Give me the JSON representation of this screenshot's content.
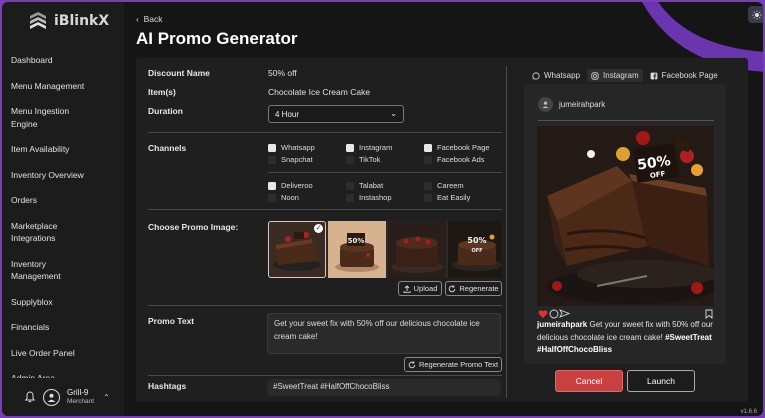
{
  "app": {
    "logo_text": "iBlinkX",
    "theme_icon": "sun-icon"
  },
  "sidebar": {
    "items": [
      {
        "label": "Dashboard"
      },
      {
        "label": "Menu Management"
      },
      {
        "label": "Menu Ingestion Engine"
      },
      {
        "label": "Item Availability"
      },
      {
        "label": "Inventory Overview"
      },
      {
        "label": "Orders"
      },
      {
        "label": "Marketplace Integrations"
      },
      {
        "label": "Inventory Management"
      },
      {
        "label": "Supplyblox"
      },
      {
        "label": "Financials"
      },
      {
        "label": "Live Order Panel"
      },
      {
        "label": "Admin Area"
      }
    ],
    "user": {
      "name": "Grill-9",
      "role": "Merchant"
    }
  },
  "header": {
    "back_label": "Back",
    "title": "AI Promo Generator"
  },
  "form": {
    "discount_label": "Discount Name",
    "discount_value": "50% off",
    "items_label": "Item(s)",
    "items_value": "Chocolate Ice Cream Cake",
    "duration_label": "Duration",
    "duration_value": "4 Hour",
    "channels_label": "Channels",
    "channels": [
      {
        "label": "Whatsapp",
        "checked": true
      },
      {
        "label": "Instagram",
        "checked": true
      },
      {
        "label": "Facebook Page",
        "checked": true
      },
      {
        "label": "Snapchat",
        "checked": false
      },
      {
        "label": "TikTok",
        "checked": false
      },
      {
        "label": "Facebook Ads",
        "checked": false
      },
      {
        "label": "Deliveroo",
        "checked": true
      },
      {
        "label": "Talabat",
        "checked": false
      },
      {
        "label": "Careem",
        "checked": false
      },
      {
        "label": "Noon",
        "checked": false
      },
      {
        "label": "Instashop",
        "checked": false
      },
      {
        "label": "Eat Easily",
        "checked": false
      }
    ],
    "image_label": "Choose Promo Image:",
    "upload_label": "Upload",
    "regenerate_label": "Regenerate",
    "promo_text_label": "Promo Text",
    "promo_text": "Get your sweet fix with 50% off our delicious chocolate ice cream cake!",
    "regenerate_text_label": "Regenerate Promo Text",
    "hashtags_label": "Hashtags",
    "hashtags": "#SweetTreat #HalfOffChocoBliss"
  },
  "preview": {
    "tabs": [
      {
        "label": "Whatsapp",
        "icon": "whatsapp-icon"
      },
      {
        "label": "Instagram",
        "icon": "instagram-icon"
      },
      {
        "label": "Facebook Page",
        "icon": "facebook-icon"
      }
    ],
    "username": "jumeirahpark",
    "badge": "50%",
    "badge_sub": "OFF",
    "caption_user": "jumeirahpark",
    "caption_text": "Get your sweet fix with 50% off our delicious chocolate ice cream cake!",
    "caption_tags": "#SweetTreat #HalfOffChocoBliss"
  },
  "actions": {
    "cancel_label": "Cancel",
    "launch_label": "Launch"
  },
  "version": "v1.6.6",
  "colors": {
    "accent_purple": "#7a3fb8",
    "cancel_red": "#c94040"
  }
}
